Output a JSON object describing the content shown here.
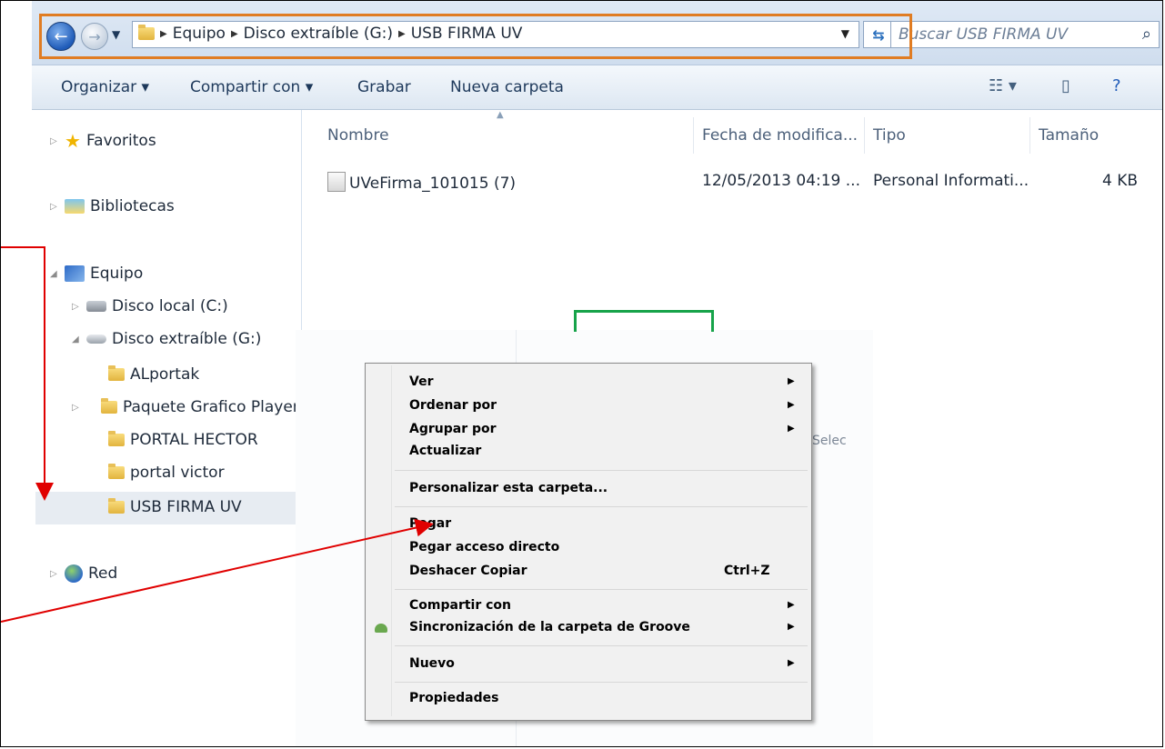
{
  "window": {
    "breadcrumbs": [
      "Equipo",
      "Disco extraíble (G:)",
      "USB FIRMA UV"
    ],
    "search_placeholder": "Buscar USB FIRMA UV"
  },
  "toolbar": {
    "organize": "Organizar ▾",
    "share": "Compartir con ▾",
    "burn": "Grabar",
    "new_folder": "Nueva carpeta"
  },
  "nav": {
    "favorites": "Favoritos",
    "libraries": "Bibliotecas",
    "computer": "Equipo",
    "local_disk": "Disco local (C:)",
    "removable": "Disco extraíble (G:)",
    "folders": [
      "ALportak",
      "Paquete Grafico Playeras",
      "PORTAL HECTOR",
      "portal victor",
      "USB FIRMA UV"
    ],
    "network": "Red"
  },
  "columns": [
    "Nombre",
    "Fecha de modifica...",
    "Tipo",
    "Tamaño"
  ],
  "files": [
    {
      "name": "UVeFirma_101015 (7)",
      "date": "12/05/2013 04:19 ...",
      "type": "Personal Informati...",
      "size": "4 KB"
    }
  ],
  "inset": {
    "side_text": "Selec"
  },
  "context_menu": {
    "items": [
      {
        "label": "Ver"
      },
      {
        "label": "Ordenar por"
      },
      {
        "label": "Agrupar por"
      },
      {
        "label": "Actualizar"
      },
      {
        "label": "Personalizar esta carpeta..."
      },
      {
        "label": "Pegar"
      },
      {
        "label": "Pegar acceso directo"
      },
      {
        "label": "Deshacer Copiar",
        "shortcut": "Ctrl+Z"
      },
      {
        "label": "Compartir con"
      },
      {
        "label": "Sincronización de la carpeta de Groove"
      },
      {
        "label": "Nuevo"
      },
      {
        "label": "Propiedades"
      }
    ]
  },
  "colors": {
    "orange_highlight": "#e07c22",
    "green_highlight": "#17a34a",
    "red_arrow": "#e00000"
  }
}
